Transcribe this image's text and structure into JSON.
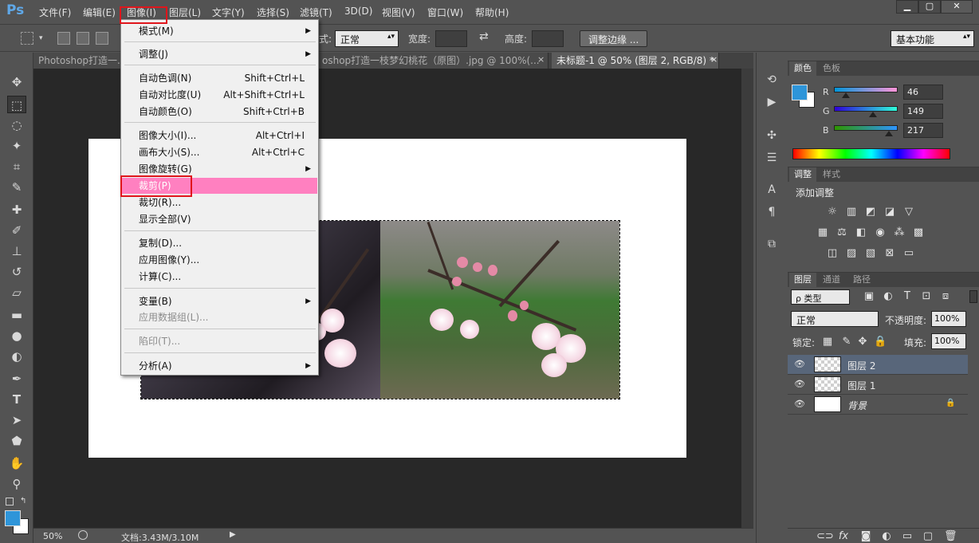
{
  "app": {
    "logo": "Ps"
  },
  "menubar": {
    "items": [
      "文件(F)",
      "编辑(E)",
      "图像(I)",
      "图层(L)",
      "文字(Y)",
      "选择(S)",
      "滤镜(T)",
      "3D(D)",
      "视图(V)",
      "窗口(W)",
      "帮助(H)"
    ],
    "window_buttons": [
      "▁",
      "▢",
      "✕"
    ]
  },
  "options": {
    "style_label": "式:",
    "style_value": "正常",
    "width_label": "宽度:",
    "height_label": "高度:",
    "refine_edge": "调整边缘 ...",
    "workspace": "基本功能"
  },
  "tabs": [
    "Photoshop打造一...",
    "oshop打造一枝梦幻桃花（原图）.jpg @ 100%(...",
    "未标题-1 @ 50% (图层 2, RGB/8) *"
  ],
  "tab_close": "×",
  "status": {
    "zoom": "50%",
    "doc": "文档:3.43M/3.10M"
  },
  "image_menu": {
    "items": [
      {
        "label": "模式(M)",
        "shortcut": "",
        "submenu": true
      },
      {
        "label": "调整(J)",
        "shortcut": "",
        "submenu": true
      },
      {
        "label": "自动色调(N)",
        "shortcut": "Shift+Ctrl+L"
      },
      {
        "label": "自动对比度(U)",
        "shortcut": "Alt+Shift+Ctrl+L"
      },
      {
        "label": "自动颜色(O)",
        "shortcut": "Shift+Ctrl+B"
      },
      {
        "label": "图像大小(I)...",
        "shortcut": "Alt+Ctrl+I"
      },
      {
        "label": "画布大小(S)...",
        "shortcut": "Alt+Ctrl+C"
      },
      {
        "label": "图像旋转(G)",
        "shortcut": "",
        "submenu": true
      },
      {
        "label": "裁剪(P)",
        "shortcut": ""
      },
      {
        "label": "裁切(R)...",
        "shortcut": ""
      },
      {
        "label": "显示全部(V)",
        "shortcut": ""
      },
      {
        "label": "复制(D)...",
        "shortcut": ""
      },
      {
        "label": "应用图像(Y)...",
        "shortcut": ""
      },
      {
        "label": "计算(C)...",
        "shortcut": ""
      },
      {
        "label": "变量(B)",
        "shortcut": "",
        "submenu": true
      },
      {
        "label": "应用数据组(L)...",
        "shortcut": "",
        "disabled": true
      },
      {
        "label": "陷印(T)...",
        "shortcut": "",
        "disabled": true
      },
      {
        "label": "分析(A)",
        "shortcut": "",
        "submenu": true
      }
    ],
    "submenu_arrow": "▶"
  },
  "color_panel": {
    "tabs": [
      "颜色",
      "色板"
    ],
    "r_label": "R",
    "g_label": "G",
    "b_label": "B",
    "r": "46",
    "g": "149",
    "b": "217",
    "fg_color": "#2e95d9"
  },
  "adjust_panel": {
    "tabs": [
      "调整",
      "样式"
    ],
    "title": "添加调整"
  },
  "layers_panel": {
    "tabs": [
      "图层",
      "通道",
      "路径"
    ],
    "filter": "ρ 类型",
    "blend_mode": "正常",
    "opacity_label": "不透明度:",
    "opacity": "100%",
    "lock_label": "锁定:",
    "fill_label": "填充:",
    "fill": "100%",
    "layers": [
      {
        "name": "图层 2",
        "selected": true
      },
      {
        "name": "图层 1",
        "selected": false
      },
      {
        "name": "背景",
        "selected": false,
        "locked": true
      }
    ]
  }
}
